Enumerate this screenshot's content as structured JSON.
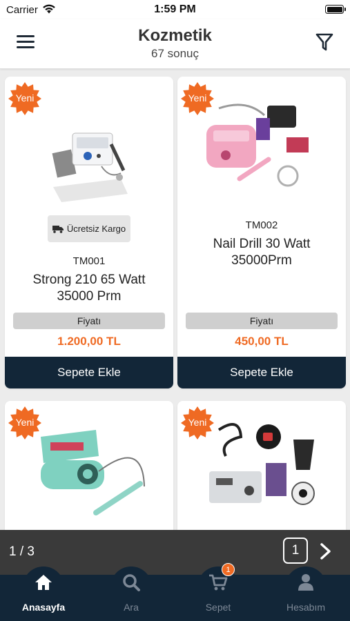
{
  "status_bar": {
    "carrier": "Carrier",
    "time": "1:59 PM"
  },
  "header": {
    "title": "Kozmetik",
    "subtitle": "67 sonuç"
  },
  "products": [
    {
      "badge": "Yeni",
      "shipping": "Ücretsiz Kargo",
      "code": "TM001",
      "name_line1": "Strong 210 65 Watt",
      "name_line2": "35000 Prm",
      "price_label": "Fiyatı",
      "price": "1.200,00 TL",
      "button": "Sepete Ekle"
    },
    {
      "badge": "Yeni",
      "code": "TM002",
      "name_line1": "Nail Drill 30 Watt",
      "name_line2": "35000Prm",
      "price_label": "Fiyatı",
      "price": "450,00 TL",
      "button": "Sepete Ekle"
    },
    {
      "badge": "Yeni"
    },
    {
      "badge": "Yeni"
    }
  ],
  "pagination": {
    "indicator": "1 / 3",
    "current_page": "1"
  },
  "tabbar": {
    "items": [
      {
        "label": "Anasayfa",
        "icon": "home-icon",
        "active": true
      },
      {
        "label": "Ara",
        "icon": "search-icon"
      },
      {
        "label": "Sepet",
        "icon": "cart-icon",
        "badge": "1"
      },
      {
        "label": "Hesabım",
        "icon": "user-icon"
      }
    ]
  },
  "colors": {
    "navy": "#122638",
    "accent": "#ef6a23",
    "pager_bg": "#3a3a3a",
    "price_bar": "#cfcfcf"
  }
}
